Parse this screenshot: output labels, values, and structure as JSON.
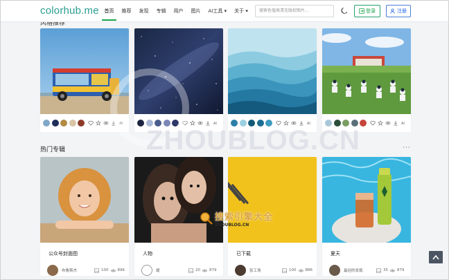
{
  "header": {
    "logo": "colorhub.me",
    "nav": [
      "首页",
      "推荐",
      "发现",
      "专辑",
      "用户",
      "图片",
      "AI工具 ▾",
      "关于 ▾"
    ],
    "search_placeholder": "搜索色值高清无版权图片...",
    "login_label": "登录",
    "register_label": "注册",
    "colors": {
      "accent": "#16a34a",
      "logo": "#2a9d8f",
      "register": "#2563eb"
    }
  },
  "recommend": {
    "title": "风格推荐",
    "cards": [
      {
        "image": "ice-cream-truck-on-beach",
        "swatches": [
          "#7fa7c6",
          "#1f2f5a",
          "#b38b43",
          "#d9c4a4",
          "#8c3b2a"
        ]
      },
      {
        "image": "starry-night-sky",
        "swatches": [
          "#1b2540",
          "#a9b8d6",
          "#4a5b8c",
          "#7b86b6",
          "#2e3866"
        ]
      },
      {
        "image": "blue-mountain-layers",
        "swatches": [
          "#2b7fa8",
          "#9bd0e2",
          "#135a78",
          "#1c6d93",
          "#3d9cc1"
        ]
      },
      {
        "image": "people-sitting-on-grass",
        "swatches": [
          "#a9c7d9",
          "#2d4f3a",
          "#7a9e62",
          "#5a6f78",
          "#c7453a"
        ]
      }
    ]
  },
  "albums": {
    "title": "热门专辑",
    "more": "···",
    "cards": [
      {
        "title": "公众号封面图",
        "user": "布鲁斯杰",
        "images": "100",
        "views": "896"
      },
      {
        "title": "人物",
        "user": "缓",
        "images": "20",
        "views": "879"
      },
      {
        "title": "已下载",
        "user": "张工场",
        "images": "100",
        "views": "886"
      },
      {
        "title": "夏天",
        "user": "最迎的发尾.",
        "images": "35",
        "views": "879"
      }
    ]
  },
  "watermark": {
    "big": "ZHOUBLOG.CN",
    "badge_cn": "搜索引擎大全",
    "badge_en": "ZHOUBLOG.CN"
  }
}
